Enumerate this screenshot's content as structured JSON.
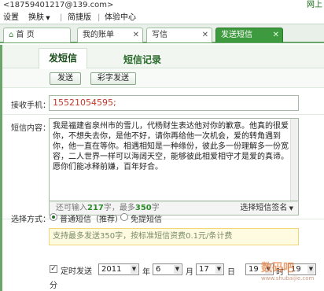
{
  "window": {
    "title": "<18759401217@139.com>",
    "right_text": "网上"
  },
  "menu": {
    "settings": "设置",
    "skin": "换肤",
    "simple": "简捷版",
    "experience": "体验中心"
  },
  "tabs": [
    {
      "label": "首 页"
    },
    {
      "label": "我的账单"
    },
    {
      "label": "写信"
    },
    {
      "label": "发送短信"
    }
  ],
  "subtabs": {
    "send": "发短信",
    "records": "短信记录"
  },
  "buttons": {
    "send": "发送",
    "color_send": "彩字发送"
  },
  "recipient": {
    "label": "接收手机：",
    "value": "15521054595;"
  },
  "message": {
    "label": "短信内容：",
    "text": "我是福建省泉州市的雪儿，代杨财生表达他对你的歉意。他真的很爱你，不想失去你，是他不好，请你再给他一次机会，爱的转角遇到你，他一直在等你。相遇相知是一种缘份，彼此多一份理解多一份宽容，二人世界一样可以海阔天空，能够彼此相爱相守才是爱的真谛。愿你们能冰释前嫌，百年好合。",
    "remain_prefix": "还可输入",
    "remain_count": "217",
    "remain_mid": "字，最多",
    "max_count": "350",
    "remain_suffix": "字",
    "signature_label": "选择短信签名"
  },
  "method": {
    "label": "选择方式：",
    "option_normal": "普通短信（推荐）",
    "option_free": "免提短信",
    "notice": "支持最多发送350字，按标准短信资费0.1元/条计费"
  },
  "schedule": {
    "label": "定时发送",
    "year": "2011",
    "year_unit": "年",
    "month": "6",
    "month_unit": "月",
    "day": "17",
    "day_unit": "日",
    "hour": "19",
    "hour_unit": "时",
    "minute": "19",
    "minute_unit": "分"
  },
  "watermark": {
    "text": "数码吧",
    "sub": "www.shubaijie.com"
  }
}
